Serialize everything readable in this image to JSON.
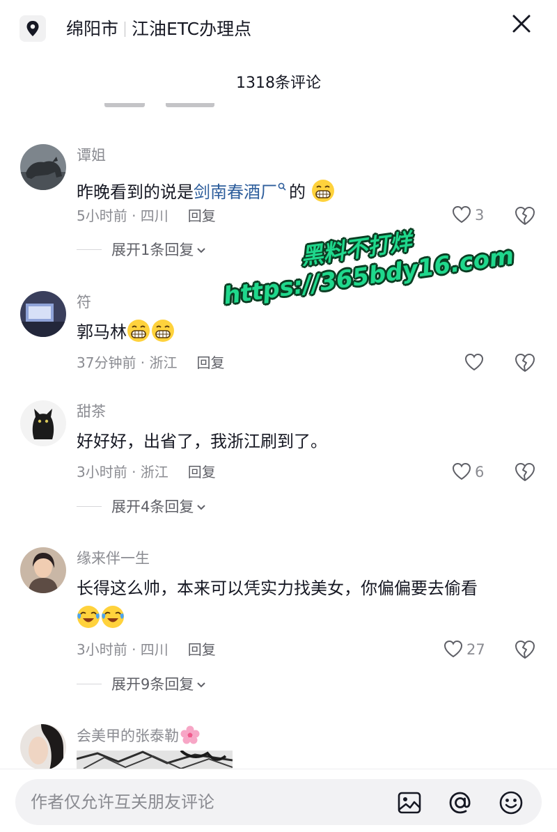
{
  "header": {
    "city": "绵阳市",
    "place": "江油ETC办理点",
    "comment_count": "1318条评论"
  },
  "comments": [
    {
      "username": "谭姐",
      "text_before": "昨晚看到的说是",
      "link_text": "剑南春酒厂",
      "text_after": "的",
      "emojis": [
        "grin-emoji"
      ],
      "time_location": "5小时前 · 四川",
      "reply_label": "回复",
      "likes": "3",
      "expand_label": "展开1条回复"
    },
    {
      "username": "符",
      "text": "郭马林",
      "emojis": [
        "grin-emoji",
        "grin-emoji"
      ],
      "time_location": "37分钟前 · 浙江",
      "reply_label": "回复",
      "likes": ""
    },
    {
      "username": "甜茶",
      "text": "好好好，出省了，我浙江刷到了。",
      "time_location": "3小时前 · 浙江",
      "reply_label": "回复",
      "likes": "6",
      "expand_label": "展开4条回复"
    },
    {
      "username": "缘来伴一生",
      "text": "长得这么帅，本来可以凭实力找美女，你偏偏要去偷看",
      "emojis": [
        "crying-laugh-emoji",
        "crying-laugh-emoji"
      ],
      "time_location": "3小时前 · 四川",
      "reply_label": "回复",
      "likes": "27",
      "expand_label": "展开9条回复"
    },
    {
      "username": "会美甲的张泰勒",
      "username_emoji": "cherry-blossom-emoji"
    }
  ],
  "watermark": {
    "line1": "黑料不打烊",
    "line2": "https://365bdy16.com"
  },
  "input": {
    "placeholder": "作者仅允许互关朋友评论"
  },
  "colors": {
    "link": "#2e5e9c",
    "watermark_fill": "#1fd88c",
    "watermark_outline": "#0a3d22",
    "meta_gray": "#8a8b91"
  }
}
